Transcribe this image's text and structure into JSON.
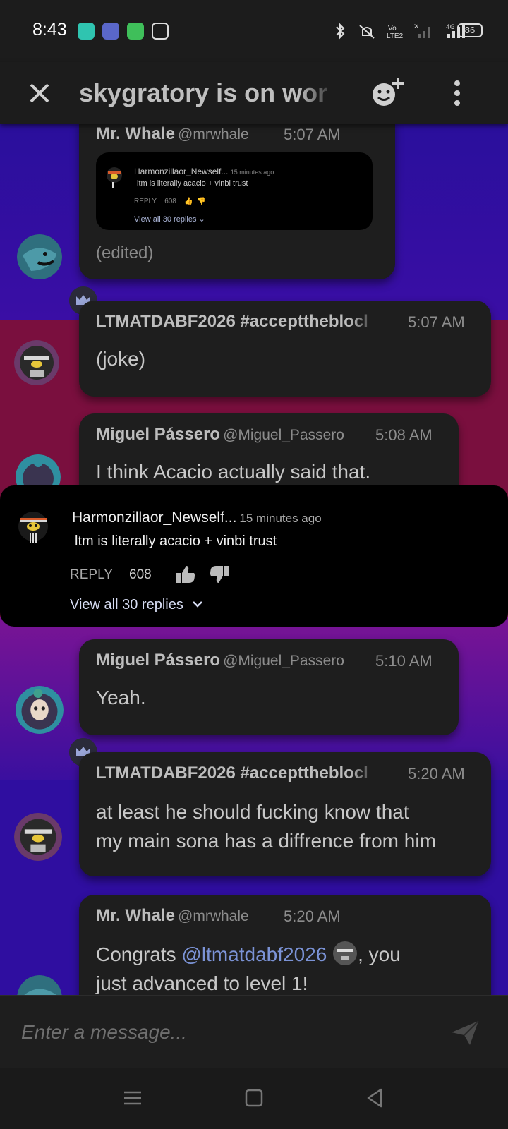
{
  "status_bar": {
    "time": "8:43",
    "battery": "86",
    "icons": [
      "bluetooth-icon",
      "mute-icon",
      "volte-icon",
      "signal-icon",
      "4g-signal-icon"
    ]
  },
  "header": {
    "title": "skygratory is on wor",
    "icons": {
      "close": "close-icon",
      "add_reaction": "add-reaction-icon",
      "menu": "more-vert-icon"
    }
  },
  "messages": [
    {
      "author": "Mr. Whale",
      "handle": "@mrwhale",
      "time": "5:07 AM",
      "text": "(edited)",
      "embed": {
        "author": "Harmonzillaor_Newself...",
        "ago": "15 minutes ago",
        "text": "ltm is literally acacio + vinbi trust",
        "reply": "REPLY",
        "count": "608",
        "view": "View all 30 replies"
      }
    },
    {
      "author": "LTMATDABF2026 #accepttheblocl",
      "time": "5:07 AM",
      "text": "(joke)"
    },
    {
      "author": "Miguel Pássero",
      "handle": "@Miguel_Passero",
      "time": "5:08 AM",
      "text": "I think Acacio actually said that."
    },
    {
      "author": "Miguel Pássero",
      "handle": "@Miguel_Passero",
      "time": "5:10 AM",
      "text": "Yeah."
    },
    {
      "author": "LTMATDABF2026 #accepttheblocl",
      "time": "5:20 AM",
      "text_line1": "at least he should fucking know that",
      "text_line2": "my main sona has a diffrence from him"
    },
    {
      "author": "Mr. Whale",
      "handle": "@mrwhale",
      "time": "5:20 AM",
      "text_before": "Congrats ",
      "mention": "@ltmatdabf2026",
      "text_after": ", you",
      "text_line2": "just advanced to level 1!"
    }
  ],
  "popup": {
    "author": "Harmonzillaor_Newself...",
    "ago": "15 minutes ago",
    "text": "ltm is literally acacio + vinbi trust",
    "reply": "REPLY",
    "count": "608",
    "view": "View all 30 replies"
  },
  "composer": {
    "placeholder": "Enter a message..."
  },
  "colors": {
    "band_blue": "#2a0f9c",
    "band_red": "#7a0f3e",
    "band_purple": "#7a1494",
    "bubble": "#1e1e1e",
    "mention": "#7b93d6"
  }
}
